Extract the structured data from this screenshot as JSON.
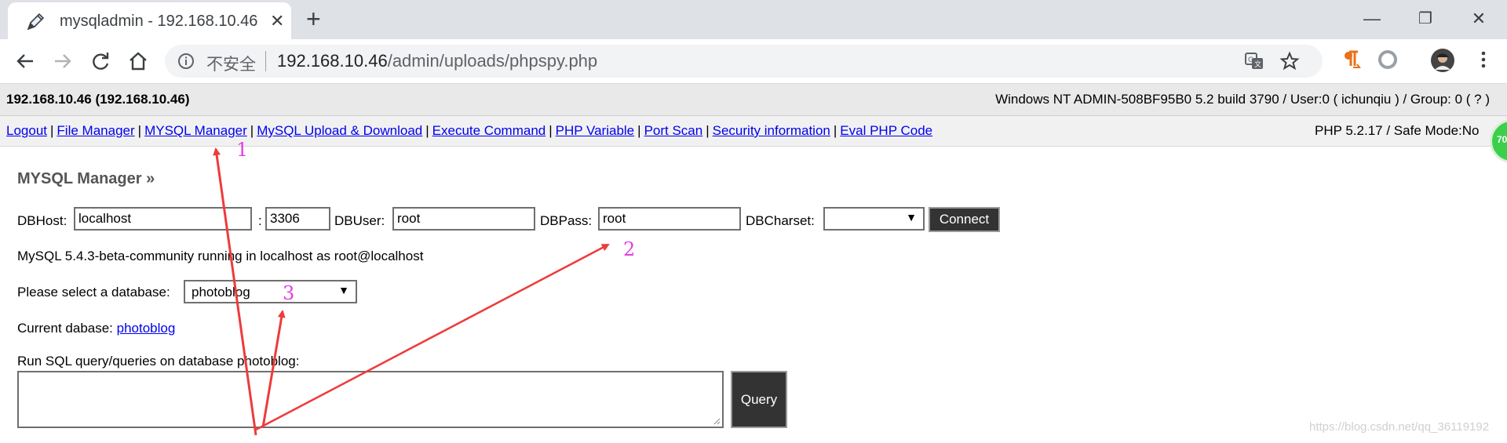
{
  "browser": {
    "tab_title": "mysqladmin - 192.168.10.46",
    "tab_close": "✕",
    "new_tab": "+",
    "window_controls": {
      "minimize": "—",
      "restore": "❐",
      "close": "✕"
    },
    "security_label": "不安全",
    "url_host": "192.168.10.46",
    "url_path": "/admin/uploads/phpspy.php"
  },
  "page": {
    "host_title": "192.168.10.46 (192.168.10.46)",
    "system_info": "Windows NT ADMIN-508BF95B0 5.2 build 3790 / User:0 ( ichunqiu ) / Group: 0 ( ? )",
    "menu": [
      "Logout",
      "File Manager",
      "MYSQL Manager",
      "MySQL Upload & Download",
      "Execute Command",
      "PHP Variable",
      "Port Scan",
      "Security information",
      "Eval PHP Code"
    ],
    "php_info": "PHP 5.2.17 / Safe Mode:No",
    "badge_text": "70",
    "section_title": "MYSQL Manager »",
    "form": {
      "dbhost_label": "DBHost:",
      "dbhost_value": "localhost",
      "port_sep": ":",
      "port_value": "3306",
      "dbuser_label": "DBUser:",
      "dbuser_value": "root",
      "dbpass_label": "DBPass:",
      "dbpass_value": "root",
      "dbcharset_label": "DBCharset:",
      "dbcharset_value": "",
      "connect_label": "Connect"
    },
    "status_line": "MySQL 5.4.3-beta-community running in localhost as root@localhost",
    "select_db_label": "Please select a database:",
    "select_db_value": "photoblog",
    "current_db_label": "Current dabase:",
    "current_db_value": "photoblog",
    "run_sql_label": "Run SQL query/queries on database photoblog:",
    "query_label": "Query",
    "watermark": "https://blog.csdn.net/qq_36119192"
  },
  "annotations": {
    "n1": "1",
    "n2": "2",
    "n3": "3",
    "arrow_color": "#ee3b3b",
    "number_color": "#e040e0"
  }
}
